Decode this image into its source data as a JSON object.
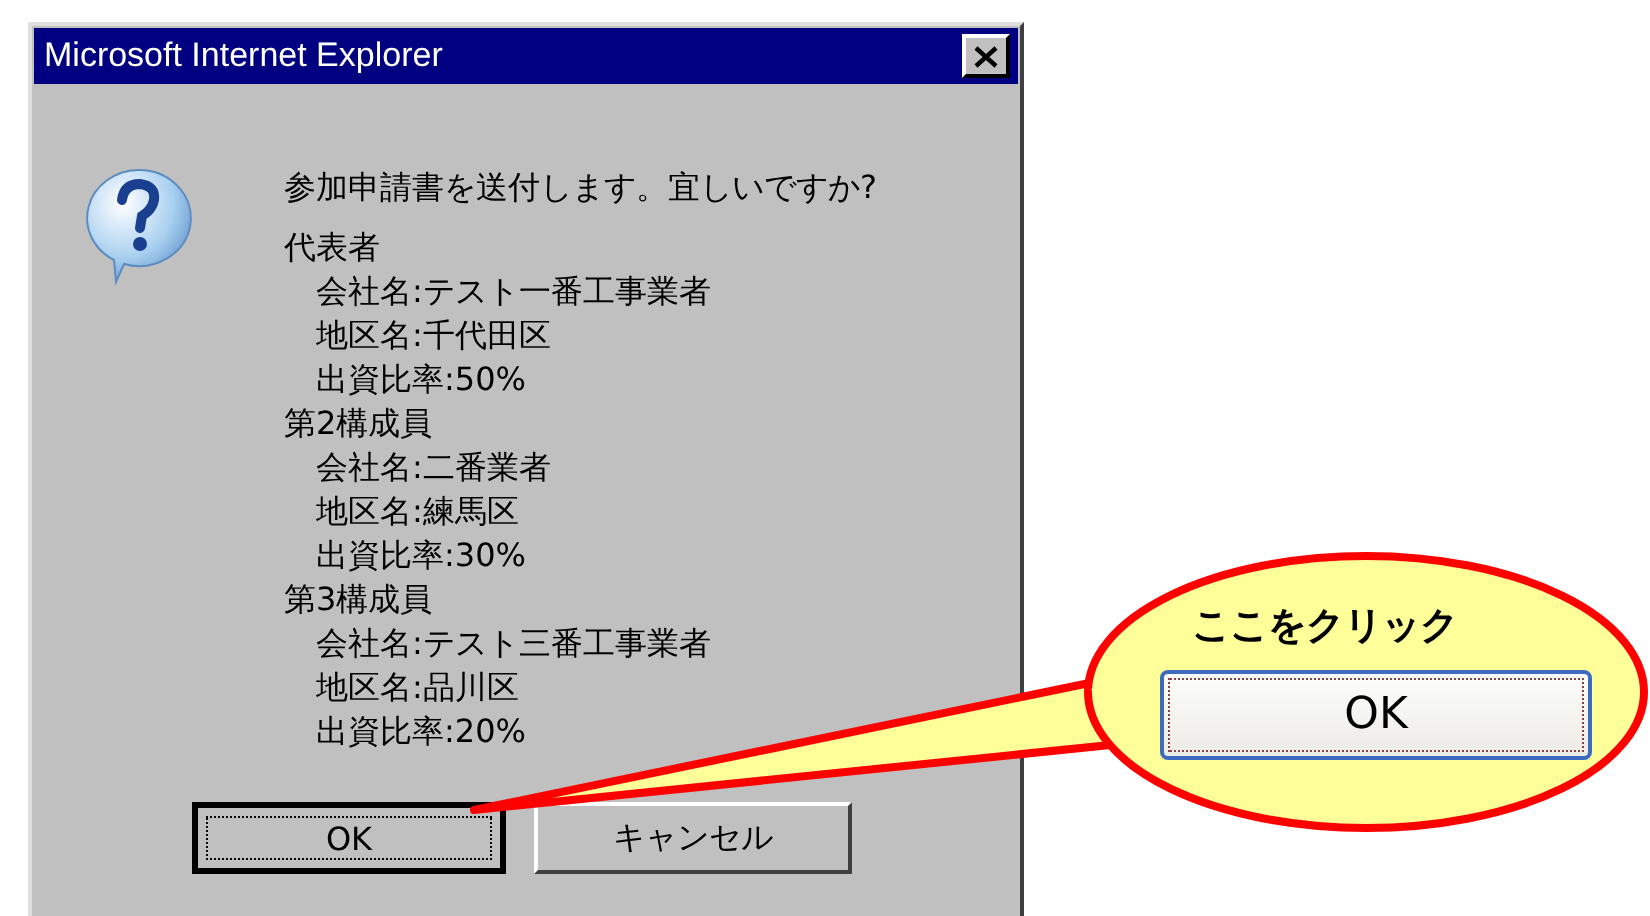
{
  "window": {
    "title": "Microsoft Internet Explorer"
  },
  "message": "参加申請書を送付します。宜しいですか?",
  "groups": [
    {
      "heading": "代表者",
      "lines": [
        "会社名:テスト一番工事業者",
        "地区名:千代田区",
        "出資比率:50%"
      ]
    },
    {
      "heading": "第2構成員",
      "lines": [
        "会社名:二番業者",
        "地区名:練馬区",
        "出資比率:30%"
      ]
    },
    {
      "heading": "第3構成員",
      "lines": [
        "会社名:テスト三番工事業者",
        "地区名:品川区",
        "出資比率:20%"
      ]
    }
  ],
  "buttons": [
    {
      "label": "OK",
      "focused": true
    },
    {
      "label": "キャンセル",
      "focused": false
    }
  ],
  "callout": {
    "text": "ここをクリック",
    "button_label": "OK"
  }
}
